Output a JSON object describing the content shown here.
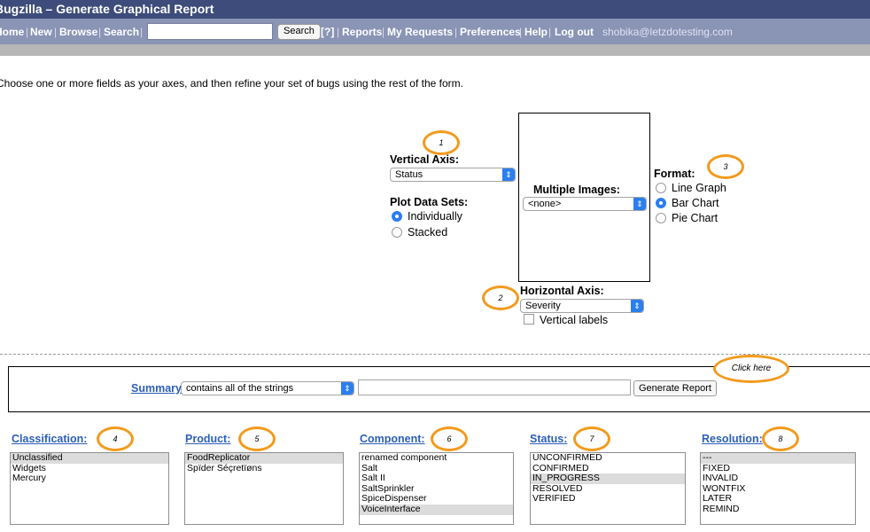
{
  "window": {
    "title": "Bugzilla – Generate Graphical Report"
  },
  "nav": {
    "home": "Home",
    "new": "New",
    "browse": "Browse",
    "search_label": "Search",
    "search_button": "Search",
    "help_q": "[?]",
    "reports": "Reports",
    "my_requests": "My Requests",
    "preferences": "Preferences",
    "help": "Help",
    "logout": "Log out",
    "user": "shobika@letzdotesting.com",
    "sep": "|"
  },
  "intro": "Choose one or more fields as your axes, and then refine your set of bugs using the rest of the form.",
  "vertical_axis": {
    "label": "Vertical Axis:",
    "value": "Status",
    "marker": "1"
  },
  "plot_data_sets": {
    "label": "Plot Data Sets:",
    "options": [
      "Individually",
      "Stacked"
    ],
    "selected": "Individually"
  },
  "multiple_images": {
    "label": "Multiple Images:",
    "value": "<none>"
  },
  "format": {
    "label": "Format:",
    "options": [
      "Line Graph",
      "Bar Chart",
      "Pie Chart"
    ],
    "selected": "Bar Chart",
    "marker": "3"
  },
  "horizontal_axis": {
    "label": "Horizontal Axis:",
    "value": "Severity",
    "vertical_labels": "Vertical labels",
    "marker": "2"
  },
  "summary": {
    "label": "Summary:",
    "operator": "contains all of the strings",
    "value": "",
    "button": "Generate Report",
    "callout": "Click here"
  },
  "fields": {
    "classification": {
      "label": "Classification:",
      "marker": "4",
      "options": [
        "Unclassified",
        "Widgets",
        "Mercury"
      ],
      "selected": [
        "Unclassified"
      ]
    },
    "product": {
      "label": "Product:",
      "marker": "5",
      "options": [
        "FoodReplicator",
        "Spïder Séçretïøns"
      ],
      "selected": [
        "FoodReplicator"
      ]
    },
    "component": {
      "label": "Component:",
      "marker": "6",
      "options": [
        "renamed component",
        "Salt",
        "Salt II",
        "SaltSprinkler",
        "SpiceDispenser",
        "VoiceInterface"
      ],
      "selected": [
        "VoiceInterface"
      ]
    },
    "status": {
      "label": "Status:",
      "marker": "7",
      "options": [
        "UNCONFIRMED",
        "CONFIRMED",
        "IN_PROGRESS",
        "RESOLVED",
        "VERIFIED"
      ],
      "selected": [
        "IN_PROGRESS"
      ]
    },
    "resolution": {
      "label": "Resolution:",
      "marker": "8",
      "options": [
        "---",
        "FIXED",
        "INVALID",
        "WONTFIX",
        "LATER",
        "REMIND"
      ],
      "selected": [
        "---"
      ]
    }
  },
  "colors": {
    "title_bar": "#3d4c7a",
    "nav_bar": "#8a94b5",
    "annotation": "#f29a1d",
    "link": "#2d5fb8",
    "accent": "#2b7ef0"
  }
}
